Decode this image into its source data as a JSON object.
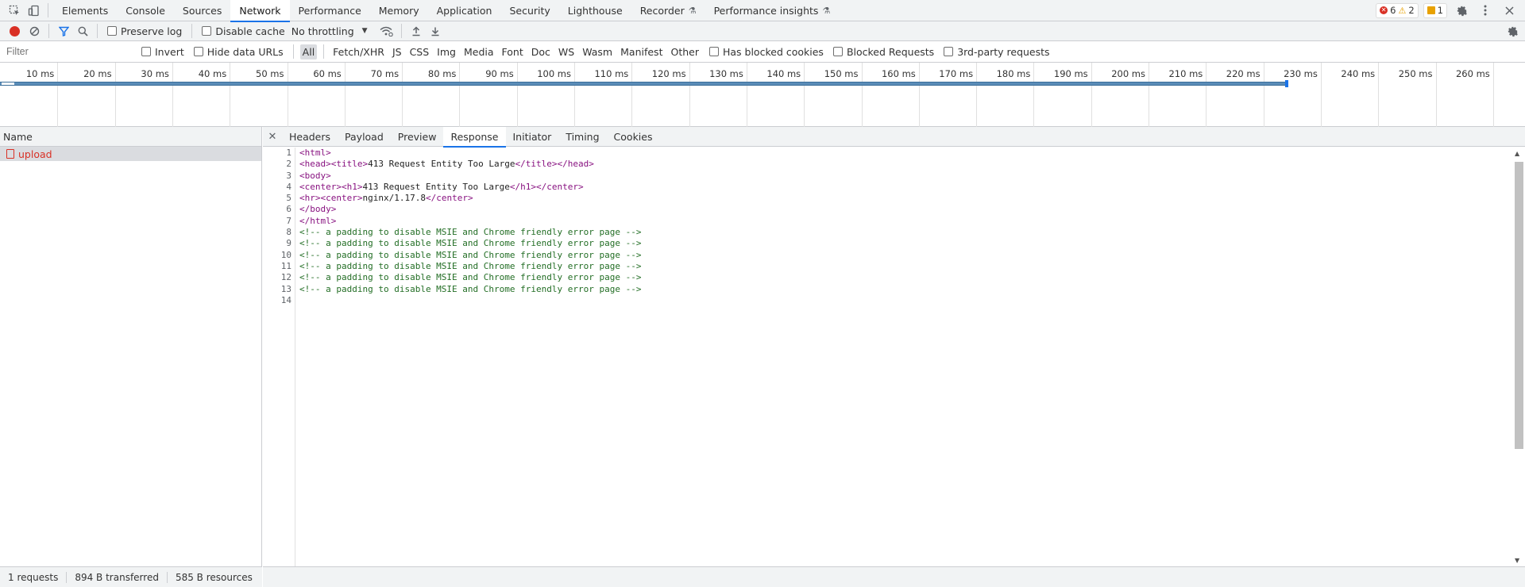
{
  "topbar": {
    "tabs": [
      {
        "label": "Elements"
      },
      {
        "label": "Console"
      },
      {
        "label": "Sources"
      },
      {
        "label": "Network",
        "selected": true
      },
      {
        "label": "Performance"
      },
      {
        "label": "Memory"
      },
      {
        "label": "Application"
      },
      {
        "label": "Security"
      },
      {
        "label": "Lighthouse"
      },
      {
        "label": "Recorder",
        "experimental": true
      },
      {
        "label": "Performance insights",
        "experimental": true
      }
    ],
    "errors": "6",
    "warnings": "2",
    "issues": "1"
  },
  "toolbar": {
    "preserve_log": "Preserve log",
    "disable_cache": "Disable cache",
    "throttling": "No throttling"
  },
  "filterbar": {
    "filter_placeholder": "Filter",
    "invert": "Invert",
    "hide_data_urls": "Hide data URLs",
    "types": [
      "All",
      "Fetch/XHR",
      "JS",
      "CSS",
      "Img",
      "Media",
      "Font",
      "Doc",
      "WS",
      "Wasm",
      "Manifest",
      "Other"
    ],
    "selected_type": "All",
    "has_blocked_cookies": "Has blocked cookies",
    "blocked_requests": "Blocked Requests",
    "third_party": "3rd-party requests"
  },
  "timeline": {
    "ticks": [
      "10 ms",
      "20 ms",
      "30 ms",
      "40 ms",
      "50 ms",
      "60 ms",
      "70 ms",
      "80 ms",
      "90 ms",
      "100 ms",
      "110 ms",
      "120 ms",
      "130 ms",
      "140 ms",
      "150 ms",
      "160 ms",
      "170 ms",
      "180 ms",
      "190 ms",
      "200 ms",
      "210 ms",
      "220 ms",
      "230 ms",
      "240 ms",
      "250 ms",
      "260 ms"
    ],
    "request_end_ms": 224
  },
  "requests": {
    "column": "Name",
    "items": [
      {
        "name": "upload",
        "status": "error"
      }
    ]
  },
  "statusbar": {
    "requests": "1 requests",
    "transferred": "894 B transferred",
    "resources": "585 B resources"
  },
  "detail": {
    "tabs": [
      "Headers",
      "Payload",
      "Preview",
      "Response",
      "Initiator",
      "Timing",
      "Cookies"
    ],
    "selected": "Response",
    "response_lines": [
      "<html>",
      "<head><title>413 Request Entity Too Large</title></head>",
      "<body>",
      "<center><h1>413 Request Entity Too Large</h1></center>",
      "<hr><center>nginx/1.17.8</center>",
      "</body>",
      "</html>",
      "<!-- a padding to disable MSIE and Chrome friendly error page -->",
      "<!-- a padding to disable MSIE and Chrome friendly error page -->",
      "<!-- a padding to disable MSIE and Chrome friendly error page -->",
      "<!-- a padding to disable MSIE and Chrome friendly error page -->",
      "<!-- a padding to disable MSIE and Chrome friendly error page -->",
      "<!-- a padding to disable MSIE and Chrome friendly error page -->",
      ""
    ]
  },
  "colors": {
    "accent": "#1a73e8",
    "error": "#d93025",
    "tag": "#881280",
    "comment": "#236e25"
  }
}
